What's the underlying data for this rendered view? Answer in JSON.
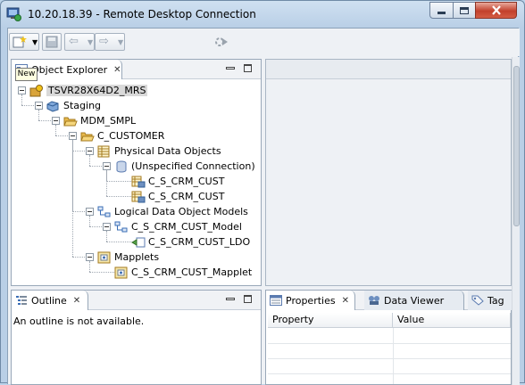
{
  "window": {
    "title": "10.20.18.39 - Remote Desktop Connection"
  },
  "tooltip": "New",
  "object_explorer": {
    "tab_label": "Object Explorer",
    "tree": [
      {
        "label": "TSVR28X64D2_MRS",
        "icon": "repository-icon",
        "selected": true
      },
      {
        "label": "Staging",
        "icon": "project-icon"
      },
      {
        "label": "MDM_SMPL",
        "icon": "folder-open-icon"
      },
      {
        "label": "C_CUSTOMER",
        "icon": "folder-open-icon"
      },
      {
        "label": "Physical Data Objects",
        "icon": "table-icon"
      },
      {
        "label": "(Unspecified Connection)",
        "icon": "database-icon"
      },
      {
        "label": "C_S_CRM_CUST",
        "icon": "data-object-icon"
      },
      {
        "label": "C_S_CRM_CUST",
        "icon": "data-object-icon"
      },
      {
        "label": "Logical Data Object Models",
        "icon": "ldo-model-icon"
      },
      {
        "label": "C_S_CRM_CUST_Model",
        "icon": "ldo-model-icon"
      },
      {
        "label": "C_S_CRM_CUST_LDO",
        "icon": "ldo-icon"
      },
      {
        "label": "Mapplets",
        "icon": "mapplet-icon"
      },
      {
        "label": "C_S_CRM_CUST_Mapplet",
        "icon": "mapplet-icon"
      }
    ]
  },
  "outline": {
    "tab_label": "Outline",
    "message": "An outline is not available."
  },
  "bottom_right": {
    "tabs": [
      {
        "label": "Properties",
        "icon": "properties-icon"
      },
      {
        "label": "Data Viewer",
        "icon": "data-viewer-icon"
      },
      {
        "label": "Tag",
        "icon": "tag-icon"
      }
    ],
    "columns": [
      "Property",
      "Value"
    ]
  },
  "colors": {
    "window_frame": "#b9cfe6",
    "folder": "#e8b84a",
    "selection": "#d9d9d9"
  }
}
